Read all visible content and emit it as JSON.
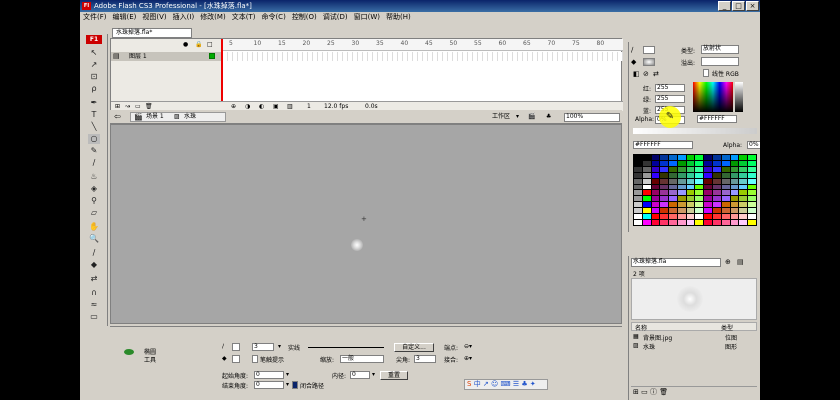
{
  "window": {
    "title": "Adobe Flash CS3 Professional - [水珠掉落.fla*]"
  },
  "menu": [
    "文件(F)",
    "编辑(E)",
    "视图(V)",
    "插入(I)",
    "修改(M)",
    "文本(T)",
    "命令(C)",
    "控制(O)",
    "调试(D)",
    "窗口(W)",
    "帮助(H)"
  ],
  "toolbox": {
    "badge": "F1"
  },
  "document": {
    "tab": "水珠掉落.fla*"
  },
  "timeline": {
    "ruler": [
      "5",
      "10",
      "15",
      "20",
      "25",
      "30",
      "35",
      "40",
      "45",
      "50",
      "55",
      "60",
      "65",
      "70",
      "75",
      "80"
    ],
    "layer": "图层 1",
    "frame": "1",
    "fps": "12.0 fps",
    "time": "0.0s"
  },
  "editbar": {
    "scene": "场景 1",
    "symbol": "水珠",
    "workspace": "工作区",
    "zoom": "100%"
  },
  "props": {
    "tool_name": "椭圆",
    "tool_sub": "工具",
    "stroke_height": "3",
    "stroke_style": "实线",
    "custom_btn": "自定义...",
    "endpoint_label": "端点:",
    "hinting_label": "笔触提示",
    "scale_label": "缩放:",
    "scale_value": "一般",
    "join_label": "接合:",
    "miter_label": "尖角:",
    "miter_value": "3",
    "start_angle_label": "起始角度:",
    "start_angle_value": "0",
    "end_angle_label": "结束角度:",
    "end_angle_value": "0",
    "inner_label": "内径:",
    "inner_value": "0",
    "close_path_label": "闭合路径",
    "reset_btn": "重置",
    "ime": "中"
  },
  "color": {
    "type_label": "类型:",
    "type_value": "放射状",
    "overflow_label": "溢出:",
    "linear_rgb": "线性 RGB",
    "red_label": "红:",
    "red_value": "255",
    "green_label": "绿:",
    "green_value": "255",
    "blue_label": "蓝:",
    "blue_value": "255",
    "alpha_label": "Alpha:",
    "alpha_value": "0%",
    "hex": "#FFFFFF",
    "swatch_hex": "#FFFFFF",
    "swatch_alpha_label": "Alpha:",
    "swatch_alpha_value": "0%"
  },
  "library": {
    "doc": "水珠掉落.fla",
    "count": "2 项",
    "col_name": "名称",
    "col_type": "类型",
    "items": [
      {
        "name": "背景图.jpg",
        "type": "位图"
      },
      {
        "name": "水珠",
        "type": "图形"
      }
    ]
  },
  "accent": "#0a246a",
  "stage_color": "#a6a6a6",
  "highlight": "#ffff00"
}
